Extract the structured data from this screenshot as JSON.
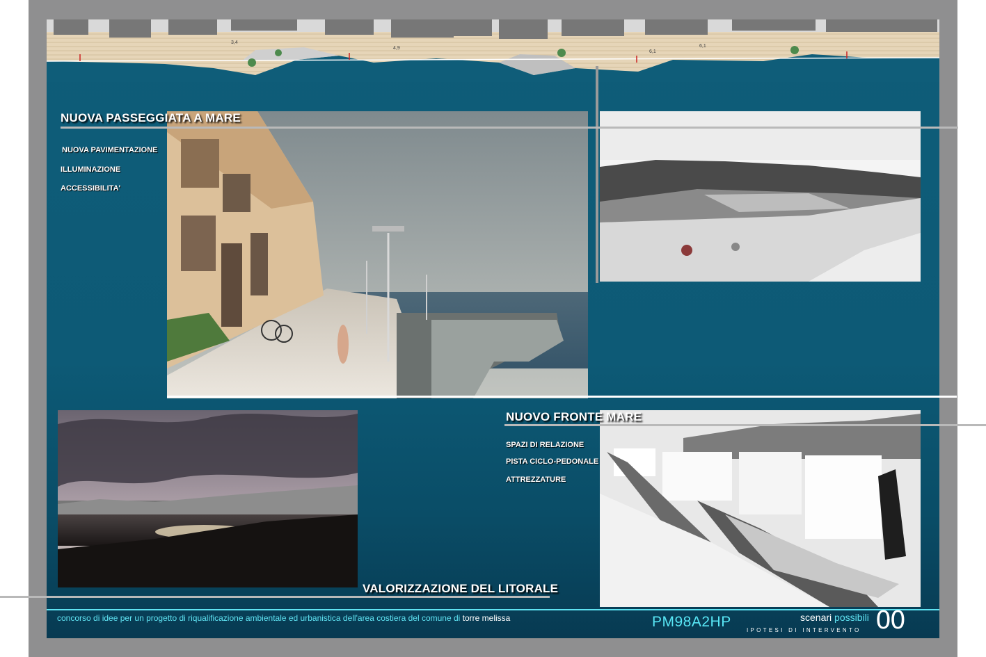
{
  "sections": {
    "passeggiata": {
      "title": "NUOVA PASSEGGIATA A MARE",
      "items": [
        "NUOVA PAVIMENTAZIONE",
        "ILLUMINAZIONE",
        "ACCESSIBILITA'"
      ]
    },
    "fronte": {
      "title": "NUOVO FRONTE MARE",
      "items": [
        "SPAZI DI RELAZIONE",
        "PISTA CICLO-PEDONALE",
        "ATTREZZATURE"
      ]
    },
    "litorale": {
      "title": "VALORIZZAZIONE DEL LITORALE"
    }
  },
  "plan": {
    "dimensions": [
      "3,4",
      "4,9",
      "6,1",
      "6,1"
    ]
  },
  "footer": {
    "description": "concorso di idee per un progetto di riqualificazione ambientale ed urbanistica dell'area costiera del comune di",
    "place": "torre melissa",
    "code": "PM98A2HP",
    "scenari_a": "scenari",
    "scenari_b": "possibili",
    "subtitle": "IPOTESI DI INTERVENTO",
    "number": "00"
  },
  "colors": {
    "board": "#0d5a76",
    "accent": "#5fe3f2",
    "frame": "#8f8f90"
  }
}
